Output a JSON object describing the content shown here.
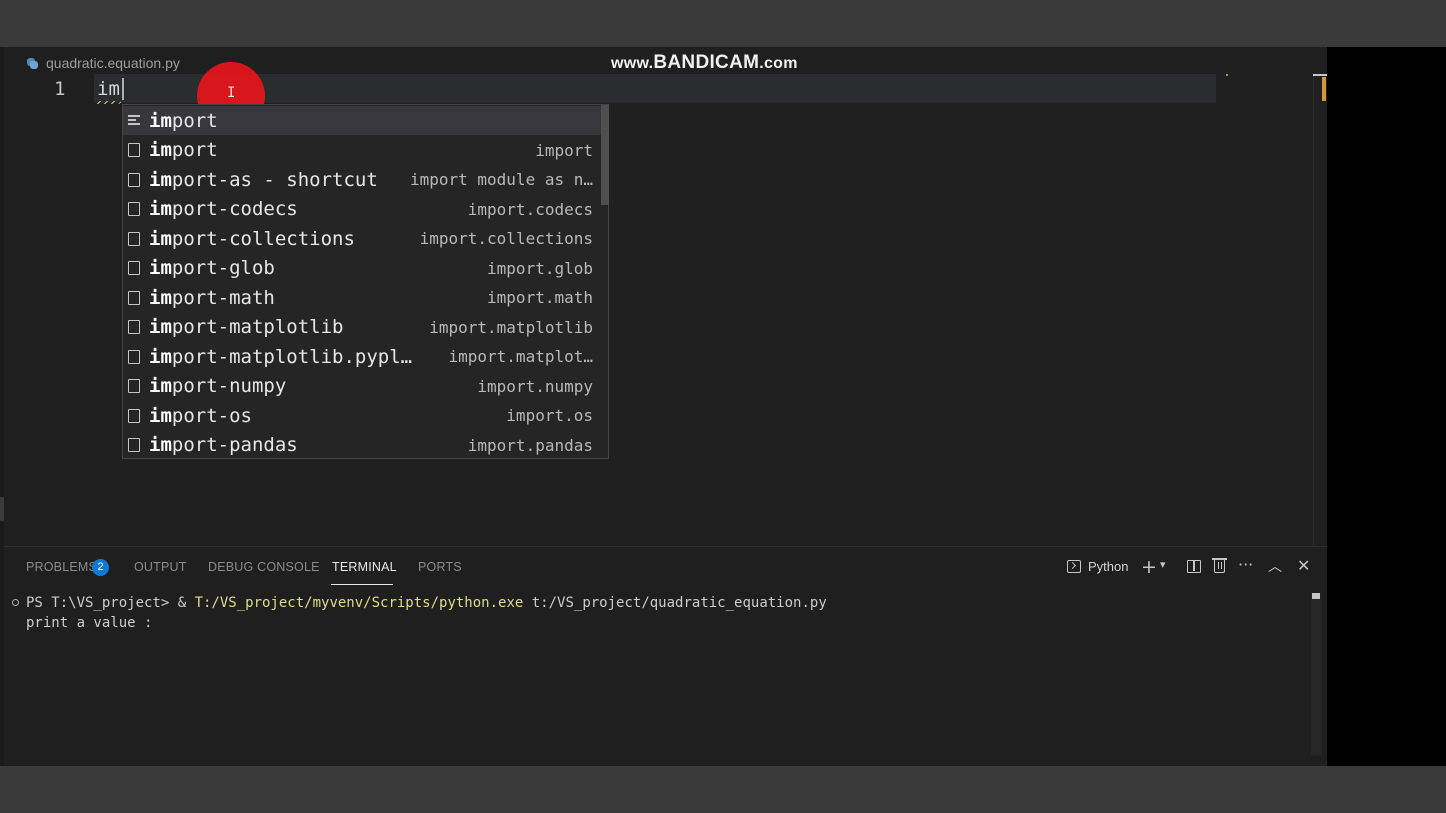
{
  "editor": {
    "tab": {
      "filename": "quadratic.equation.py",
      "icon": "python-file-icon"
    },
    "watermark": {
      "prefix": "www.",
      "brand": "BANDICAM",
      "suffix": ".com"
    },
    "line_number": "1",
    "typed_text": "im"
  },
  "suggestions": {
    "items": [
      {
        "match": "im",
        "rest": "port",
        "detail": "",
        "kind": "keyword",
        "selected": true
      },
      {
        "match": "im",
        "rest": "port",
        "detail": "import",
        "kind": "snippet"
      },
      {
        "match": "im",
        "rest": "port-as - shortcut",
        "detail": "import module as n…",
        "kind": "snippet"
      },
      {
        "match": "im",
        "rest": "port-codecs",
        "detail": "import.codecs",
        "kind": "snippet"
      },
      {
        "match": "im",
        "rest": "port-collections",
        "detail": "import.collections",
        "kind": "snippet"
      },
      {
        "match": "im",
        "rest": "port-glob",
        "detail": "import.glob",
        "kind": "snippet"
      },
      {
        "match": "im",
        "rest": "port-math",
        "detail": "import.math",
        "kind": "snippet"
      },
      {
        "match": "im",
        "rest": "port-matplotlib",
        "detail": "import.matplotlib",
        "kind": "snippet"
      },
      {
        "match": "im",
        "rest": "port-matplotlib.pypl…",
        "detail": "import.matplot…",
        "kind": "snippet"
      },
      {
        "match": "im",
        "rest": "port-numpy",
        "detail": "import.numpy",
        "kind": "snippet"
      },
      {
        "match": "im",
        "rest": "port-os",
        "detail": "import.os",
        "kind": "snippet"
      },
      {
        "match": "im",
        "rest": "port-pandas",
        "detail": "import.pandas",
        "kind": "snippet"
      }
    ]
  },
  "panel": {
    "tabs": {
      "problems": "PROBLEMS",
      "problems_count": "2",
      "output": "OUTPUT",
      "debug_console": "DEBUG CONSOLE",
      "terminal": "TERMINAL",
      "ports": "PORTS"
    },
    "active_tab": "TERMINAL",
    "terminal_name": "Python",
    "terminal": {
      "line1": {
        "prompt": "PS T:\\VS_project> & ",
        "exe": "T:/VS_project/myvenv/Scripts/python.exe",
        "args": " t:/VS_project/quadratic_equation.py"
      },
      "line2": "print a value :"
    },
    "colors": {
      "badge": "#0e7ad1",
      "exe_path": "#dcdc8b",
      "click_marker": "#e0161b"
    }
  }
}
